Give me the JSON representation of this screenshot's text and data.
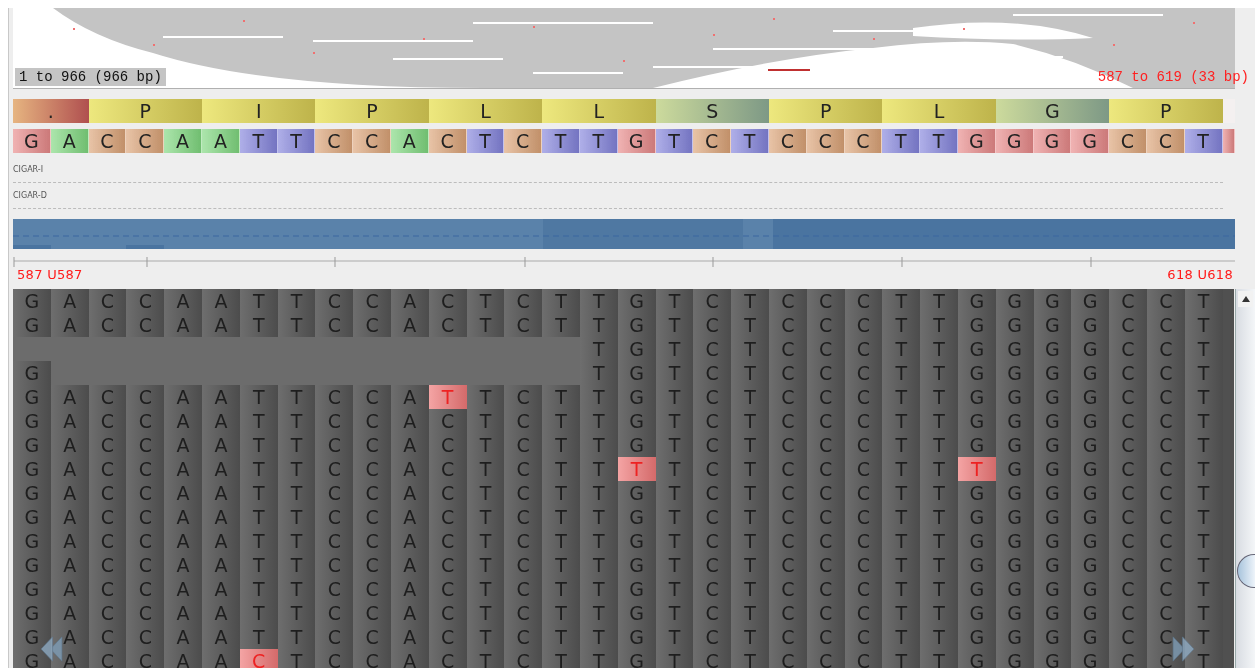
{
  "overview": {
    "range_label": "1 to 966 (966 bp)",
    "visible_label": "587 to 619 (33 bp)"
  },
  "translation": [
    {
      "kind": "lead",
      "aa": ".",
      "color": "#c85a5a"
    },
    {
      "kind": "codon",
      "aa": "P",
      "color": "#d8cc55"
    },
    {
      "kind": "codon",
      "aa": "I",
      "color": "#d8cc55"
    },
    {
      "kind": "codon",
      "aa": "P",
      "color": "#d8cc55"
    },
    {
      "kind": "codon",
      "aa": "L",
      "color": "#d8cc55"
    },
    {
      "kind": "codon",
      "aa": "L",
      "color": "#d8cc55"
    },
    {
      "kind": "codon",
      "aa": "S",
      "color": "#8fae98"
    },
    {
      "kind": "codon",
      "aa": "P",
      "color": "#d8cc55"
    },
    {
      "kind": "codon",
      "aa": "L",
      "color": "#d8cc55"
    },
    {
      "kind": "codon",
      "aa": "G",
      "color": "#8fae98"
    },
    {
      "kind": "codon",
      "aa": "P",
      "color": "#d8cc55"
    },
    {
      "kind": "tail",
      "color": "#f4f0f0"
    }
  ],
  "reference": [
    {
      "base": "G",
      "color": "#e88a8a"
    },
    {
      "base": "A",
      "color": "#80d880"
    },
    {
      "base": "C",
      "color": "#dca478"
    },
    {
      "base": "C",
      "color": "#dca478"
    },
    {
      "base": "A",
      "color": "#80d880"
    },
    {
      "base": "A",
      "color": "#80d880"
    },
    {
      "base": "T",
      "color": "#8484dc"
    },
    {
      "base": "T",
      "color": "#8484dc"
    },
    {
      "base": "C",
      "color": "#dca478"
    },
    {
      "base": "C",
      "color": "#dca478"
    },
    {
      "base": "A",
      "color": "#80d880"
    },
    {
      "base": "C",
      "color": "#dca478"
    },
    {
      "base": "T",
      "color": "#8484dc"
    },
    {
      "base": "C",
      "color": "#dca478"
    },
    {
      "base": "T",
      "color": "#8484dc"
    },
    {
      "base": "T",
      "color": "#8484dc"
    },
    {
      "base": "G",
      "color": "#e88a8a"
    },
    {
      "base": "T",
      "color": "#8484dc"
    },
    {
      "base": "C",
      "color": "#dca478"
    },
    {
      "base": "T",
      "color": "#8484dc"
    },
    {
      "base": "C",
      "color": "#dca478"
    },
    {
      "base": "C",
      "color": "#dca478"
    },
    {
      "base": "C",
      "color": "#dca478"
    },
    {
      "base": "T",
      "color": "#8484dc"
    },
    {
      "base": "T",
      "color": "#8484dc"
    },
    {
      "base": "G",
      "color": "#e88a8a"
    },
    {
      "base": "G",
      "color": "#e88a8a"
    },
    {
      "base": "G",
      "color": "#e88a8a"
    },
    {
      "base": "G",
      "color": "#e88a8a"
    },
    {
      "base": "C",
      "color": "#dca478"
    },
    {
      "base": "C",
      "color": "#dca478"
    },
    {
      "base": "T",
      "color": "#8484dc"
    },
    {
      "kind": "tail",
      "color": "#e88a8a"
    }
  ],
  "tracks": [
    "CIGAR-I",
    "CIGAR-D"
  ],
  "ruler": {
    "start": "587 U587",
    "end": "618 U618"
  },
  "reads": [
    {
      "cells": [
        "G",
        "A",
        "C",
        "C",
        "A",
        "A",
        "T",
        "T",
        "C",
        "C",
        "A",
        "C",
        "T",
        "C",
        "T",
        "T",
        "G",
        "T",
        "C",
        "T",
        "C",
        "C",
        "C",
        "T",
        "T",
        "G",
        "G",
        "G",
        "G",
        "C",
        "C",
        "T"
      ]
    },
    {
      "cells": [
        "G",
        "A",
        "C",
        "C",
        "A",
        "A",
        "T",
        "T",
        "C",
        "C",
        "A",
        "C",
        "T",
        "C",
        "T",
        "T",
        "G",
        "T",
        "C",
        "T",
        "C",
        "C",
        "C",
        "T",
        "T",
        "G",
        "G",
        "G",
        "G",
        "C",
        "C",
        "T"
      ]
    },
    {
      "cells": [
        {
          "kind": "gap"
        },
        {
          "kind": "gap"
        },
        {
          "kind": "gap"
        },
        {
          "kind": "gap"
        },
        {
          "kind": "gap"
        },
        {
          "kind": "gap"
        },
        {
          "kind": "gap"
        },
        {
          "kind": "gap"
        },
        {
          "kind": "gap"
        },
        {
          "kind": "gap"
        },
        {
          "kind": "gap"
        },
        {
          "kind": "gap"
        },
        {
          "kind": "gap"
        },
        {
          "kind": "gap"
        },
        {
          "kind": "gap"
        },
        "T",
        "G",
        "T",
        "C",
        "T",
        "C",
        "C",
        "C",
        "T",
        "T",
        "G",
        "G",
        "G",
        "G",
        "C",
        "C",
        "T"
      ]
    },
    {
      "cells": [
        "G",
        {
          "kind": "gap"
        },
        {
          "kind": "gap"
        },
        {
          "kind": "gap"
        },
        {
          "kind": "gap"
        },
        {
          "kind": "gap"
        },
        {
          "kind": "gap"
        },
        {
          "kind": "gap"
        },
        {
          "kind": "gap"
        },
        {
          "kind": "gap"
        },
        {
          "kind": "gap"
        },
        {
          "kind": "gap"
        },
        {
          "kind": "gap"
        },
        {
          "kind": "gap"
        },
        {
          "kind": "gap"
        },
        "T",
        "G",
        "T",
        "C",
        "T",
        "C",
        "C",
        "C",
        "T",
        "T",
        "G",
        "G",
        "G",
        "G",
        "C",
        "C",
        "T"
      ]
    },
    {
      "cells": [
        "G",
        "A",
        "C",
        "C",
        "A",
        "A",
        "T",
        "T",
        "C",
        "C",
        "A",
        {
          "kind": "mismatch",
          "base": "T"
        },
        "T",
        "C",
        "T",
        "T",
        "G",
        "T",
        "C",
        "T",
        "C",
        "C",
        "C",
        "T",
        "T",
        "G",
        "G",
        "G",
        "G",
        "C",
        "C",
        "T"
      ]
    },
    {
      "cells": [
        "G",
        "A",
        "C",
        "C",
        "A",
        "A",
        "T",
        "T",
        "C",
        "C",
        "A",
        "C",
        "T",
        "C",
        "T",
        "T",
        "G",
        "T",
        "C",
        "T",
        "C",
        "C",
        "C",
        "T",
        "T",
        "G",
        "G",
        "G",
        "G",
        "C",
        "C",
        "T"
      ]
    },
    {
      "cells": [
        "G",
        "A",
        "C",
        "C",
        "A",
        "A",
        "T",
        "T",
        "C",
        "C",
        "A",
        "C",
        "T",
        "C",
        "T",
        "T",
        "G",
        "T",
        "C",
        "T",
        "C",
        "C",
        "C",
        "T",
        "T",
        "G",
        "G",
        "G",
        "G",
        "C",
        "C",
        "T"
      ]
    },
    {
      "cells": [
        "G",
        "A",
        "C",
        "C",
        "A",
        "A",
        "T",
        "T",
        "C",
        "C",
        "A",
        "C",
        "T",
        "C",
        "T",
        "T",
        {
          "kind": "mismatch",
          "base": "T"
        },
        "T",
        "C",
        "T",
        "C",
        "C",
        "C",
        "T",
        "T",
        {
          "kind": "mismatch",
          "base": "T"
        },
        "G",
        "G",
        "G",
        "C",
        "C",
        "T"
      ]
    },
    {
      "cells": [
        "G",
        "A",
        "C",
        "C",
        "A",
        "A",
        "T",
        "T",
        "C",
        "C",
        "A",
        "C",
        "T",
        "C",
        "T",
        "T",
        "G",
        "T",
        "C",
        "T",
        "C",
        "C",
        "C",
        "T",
        "T",
        "G",
        "G",
        "G",
        "G",
        "C",
        "C",
        "T"
      ]
    },
    {
      "cells": [
        "G",
        "A",
        "C",
        "C",
        "A",
        "A",
        "T",
        "T",
        "C",
        "C",
        "A",
        "C",
        "T",
        "C",
        "T",
        "T",
        "G",
        "T",
        "C",
        "T",
        "C",
        "C",
        "C",
        "T",
        "T",
        "G",
        "G",
        "G",
        "G",
        "C",
        "C",
        "T"
      ]
    },
    {
      "cells": [
        "G",
        "A",
        "C",
        "C",
        "A",
        "A",
        "T",
        "T",
        "C",
        "C",
        "A",
        "C",
        "T",
        "C",
        "T",
        "T",
        "G",
        "T",
        "C",
        "T",
        "C",
        "C",
        "C",
        "T",
        "T",
        "G",
        "G",
        "G",
        "G",
        "C",
        "C",
        "T"
      ]
    },
    {
      "cells": [
        "G",
        "A",
        "C",
        "C",
        "A",
        "A",
        "T",
        "T",
        "C",
        "C",
        "A",
        "C",
        "T",
        "C",
        "T",
        "T",
        "G",
        "T",
        "C",
        "T",
        "C",
        "C",
        "C",
        "T",
        "T",
        "G",
        "G",
        "G",
        "G",
        "C",
        "C",
        "T"
      ]
    },
    {
      "cells": [
        "G",
        "A",
        "C",
        "C",
        "A",
        "A",
        "T",
        "T",
        "C",
        "C",
        "A",
        "C",
        "T",
        "C",
        "T",
        "T",
        "G",
        "T",
        "C",
        "T",
        "C",
        "C",
        "C",
        "T",
        "T",
        "G",
        "G",
        "G",
        "G",
        "C",
        "C",
        "T"
      ]
    },
    {
      "cells": [
        "G",
        "A",
        "C",
        "C",
        "A",
        "A",
        "T",
        "T",
        "C",
        "C",
        "A",
        "C",
        "T",
        "C",
        "T",
        "T",
        "G",
        "T",
        "C",
        "T",
        "C",
        "C",
        "C",
        "T",
        "T",
        "G",
        "G",
        "G",
        "G",
        "C",
        "C",
        "T"
      ]
    },
    {
      "cells": [
        "G",
        "A",
        "C",
        "C",
        "A",
        "A",
        "T",
        "T",
        "C",
        "C",
        "A",
        "C",
        "T",
        "C",
        "T",
        "T",
        "G",
        "T",
        "C",
        "T",
        "C",
        "C",
        "C",
        "T",
        "T",
        "G",
        "G",
        "G",
        "G",
        "C",
        "C",
        "T"
      ]
    },
    {
      "cells": [
        "G",
        "A",
        "C",
        "C",
        "A",
        "A",
        {
          "kind": "mismatch",
          "base": "C"
        },
        "T",
        "C",
        "C",
        "A",
        "C",
        "T",
        "C",
        "T",
        "T",
        "G",
        "T",
        "C",
        "T",
        "C",
        "C",
        "C",
        "T",
        "T",
        "G",
        "G",
        "G",
        "G",
        "C",
        "C",
        "T"
      ]
    }
  ]
}
